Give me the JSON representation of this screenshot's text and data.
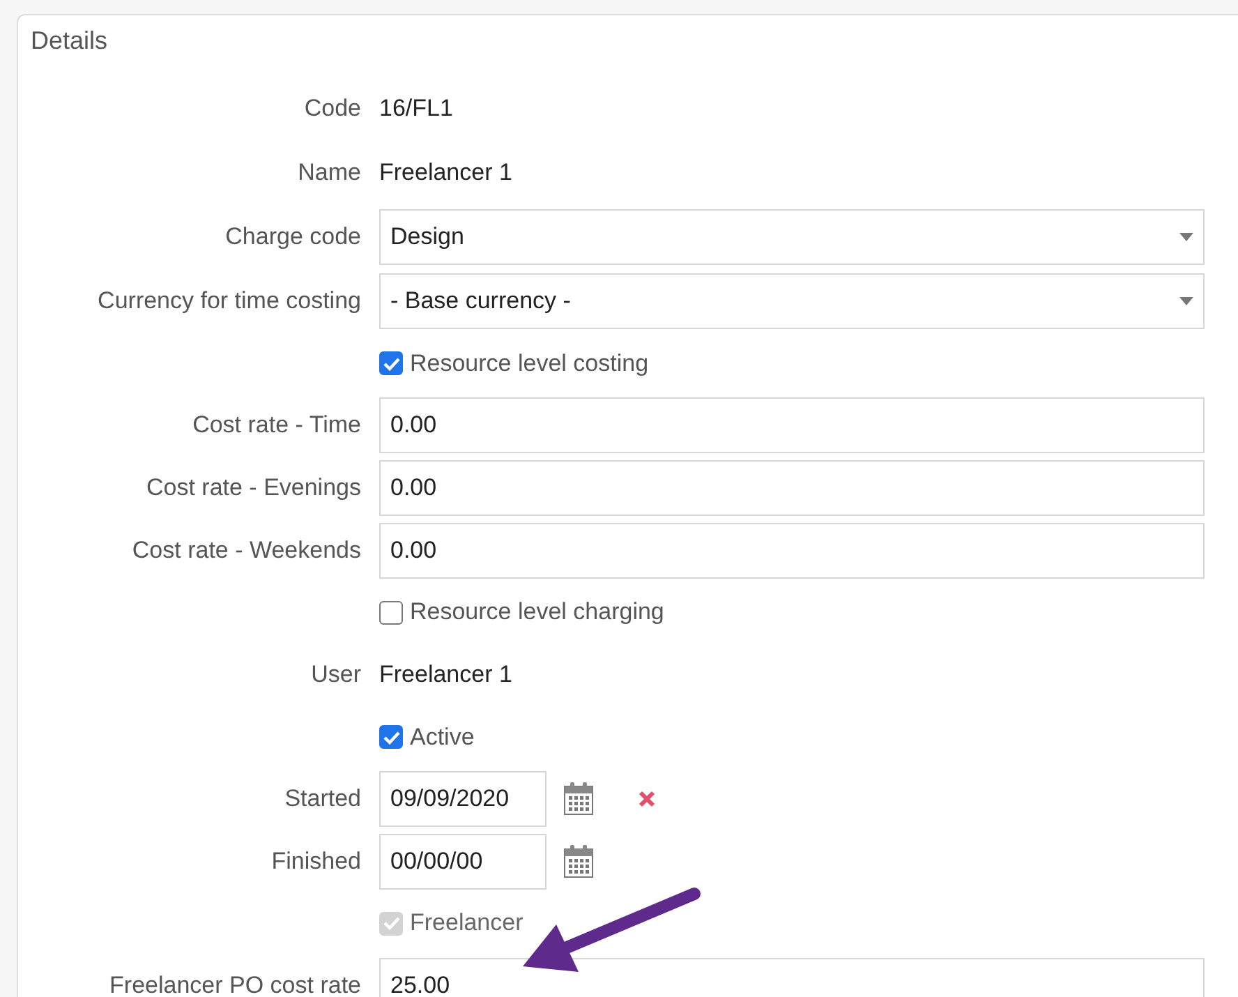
{
  "panel": {
    "title": "Details"
  },
  "rows": [
    {
      "kind": "text",
      "label": "Code",
      "value": "16/FL1"
    },
    {
      "kind": "text",
      "label": "Name",
      "value": "Freelancer 1"
    },
    {
      "kind": "select",
      "label": "Charge code",
      "value": "Design"
    },
    {
      "kind": "select",
      "label": "Currency for time costing",
      "value": "- Base currency -"
    },
    {
      "kind": "checkbox",
      "text": "Resource level costing",
      "checked": true,
      "disabled": false
    },
    {
      "kind": "input",
      "label": "Cost rate - Time",
      "value": "0.00"
    },
    {
      "kind": "input",
      "label": "Cost rate - Evenings",
      "value": "0.00"
    },
    {
      "kind": "input",
      "label": "Cost rate - Weekends",
      "value": "0.00"
    },
    {
      "kind": "checkbox",
      "text": "Resource level charging",
      "checked": false,
      "disabled": false
    },
    {
      "kind": "text",
      "label": "User",
      "value": "Freelancer 1"
    },
    {
      "kind": "checkbox",
      "text": "Active",
      "checked": true,
      "disabled": false
    },
    {
      "kind": "date",
      "label": "Started",
      "value": "09/09/2020",
      "clearable": true
    },
    {
      "kind": "date",
      "label": "Finished",
      "value": "00/00/00",
      "clearable": false
    },
    {
      "kind": "checkbox",
      "text": "Freelancer",
      "checked": true,
      "disabled": true
    },
    {
      "kind": "input",
      "label": "Freelancer PO cost rate",
      "value": "25.00"
    }
  ]
}
